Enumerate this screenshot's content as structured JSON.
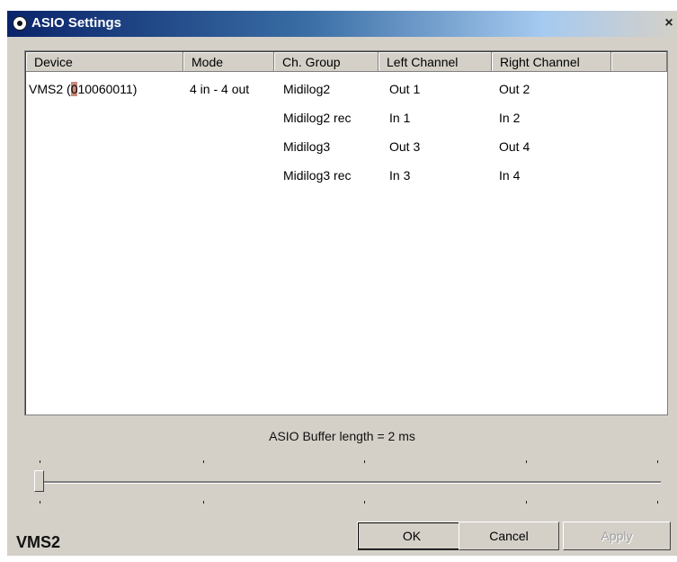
{
  "window": {
    "title": "ASIO Settings",
    "close_label": "×"
  },
  "columns": [
    "Device",
    "Mode",
    "Ch. Group",
    "Left Channel",
    "Right Channel"
  ],
  "device": {
    "name_prefix": "VMS2 (",
    "name_highlight": "0",
    "name_suffix": "10060011)",
    "mode": "4 in - 4 out"
  },
  "rows": [
    {
      "group": "Midilog2",
      "left": "Out 1",
      "right": "Out 2"
    },
    {
      "group": "Midilog2 rec",
      "left": "In 1",
      "right": "In 2"
    },
    {
      "group": "Midilog3",
      "left": "Out 3",
      "right": "Out 4"
    },
    {
      "group": "Midilog3 rec",
      "left": "In 3",
      "right": "In 4"
    }
  ],
  "buffer": {
    "label": "ASIO Buffer length = 2 ms",
    "slider_position": 0
  },
  "footer": {
    "brand": "VMS2",
    "ok_label": "OK",
    "cancel_label": "Cancel",
    "apply_label": "Apply"
  }
}
